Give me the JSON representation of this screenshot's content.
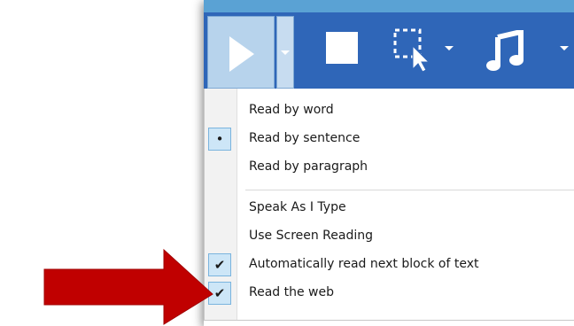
{
  "toolbar": {
    "play_icon": "play-icon",
    "play_dropdown_icon": "chevron-down-icon",
    "stop_icon": "stop-icon",
    "select_icon": "select-pointer-icon",
    "music_icon": "music-note-icon",
    "background_color": "#2f66b8"
  },
  "menu": {
    "items": [
      {
        "label": "Read by word",
        "marker": ""
      },
      {
        "label": "Read by sentence",
        "marker": "•"
      },
      {
        "label": "Read by paragraph",
        "marker": ""
      },
      {
        "label": "Speak As I Type",
        "marker": ""
      },
      {
        "label": "Use Screen Reading",
        "marker": ""
      },
      {
        "label": "Automatically read next block of text",
        "marker": "✔"
      },
      {
        "label": "Read the web",
        "marker": "✔"
      }
    ]
  },
  "annotation": {
    "arrow_color": "#c00000",
    "arrow_icon": "red-arrow-icon"
  }
}
